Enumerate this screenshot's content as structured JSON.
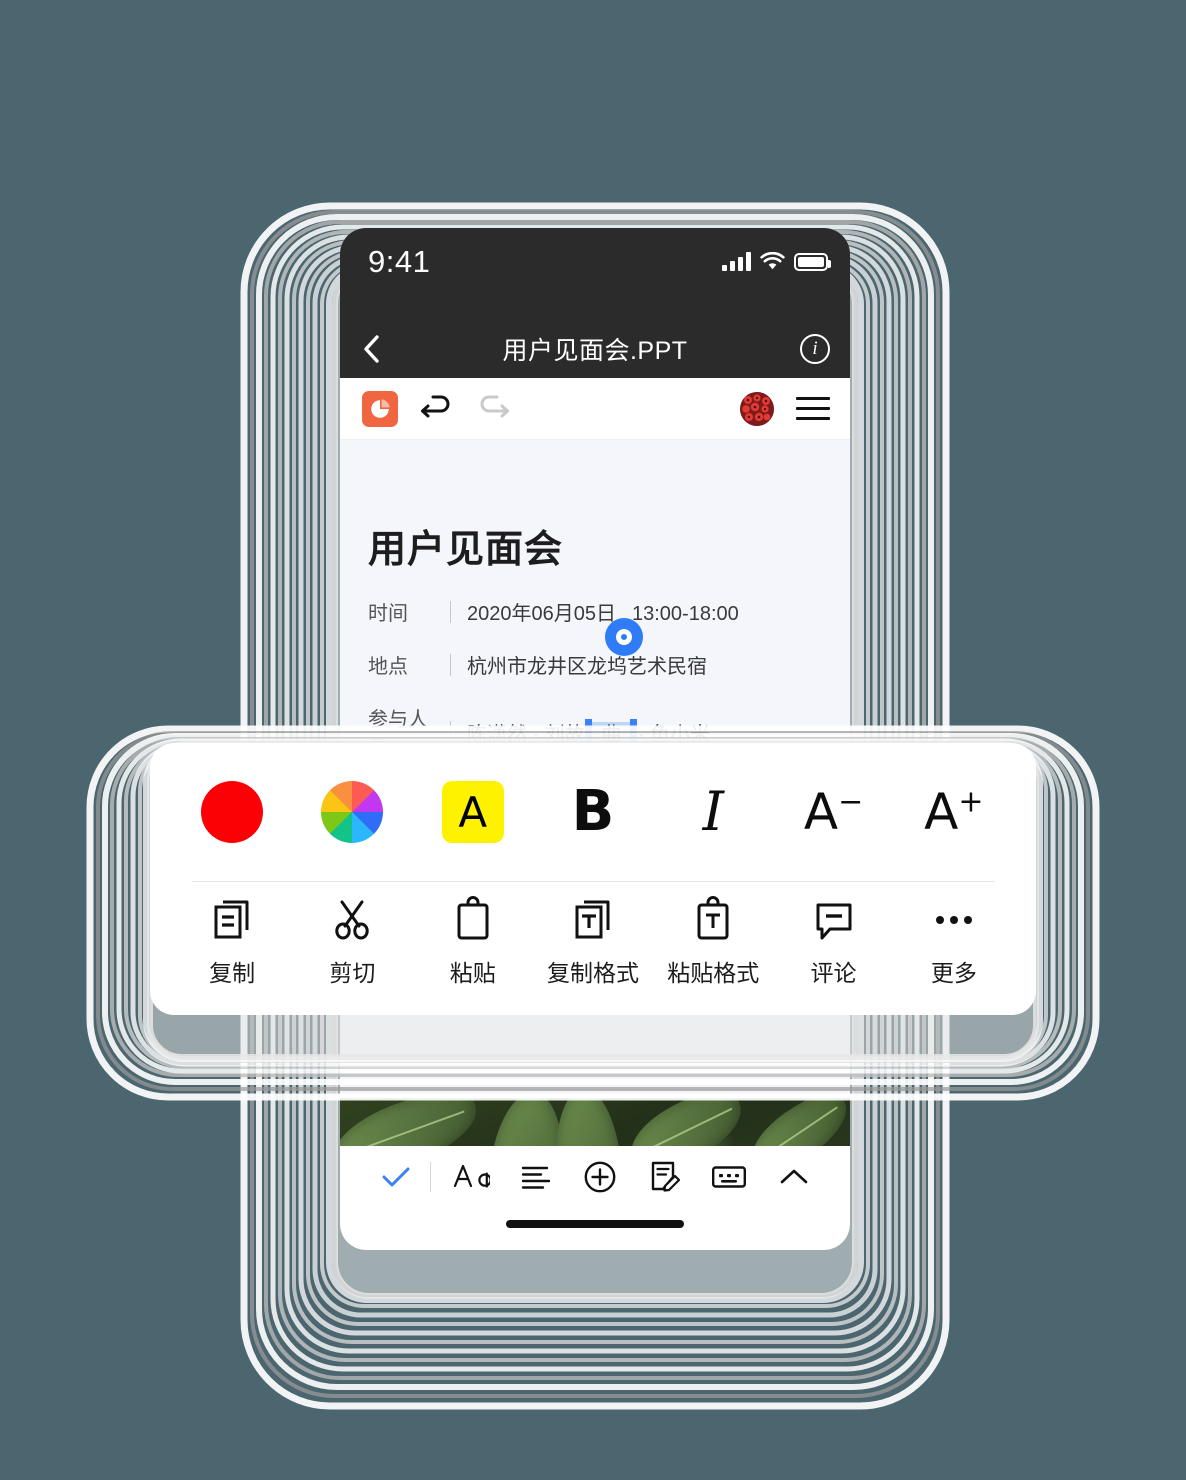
{
  "background_color": "#4b666f",
  "status_bar": {
    "time": "9:41",
    "signal_icon": "cellular-bars-icon",
    "wifi_icon": "wifi-icon",
    "battery_icon": "battery-full-icon"
  },
  "nav_bar": {
    "back_icon": "chevron-left-icon",
    "title": "用户见面会.PPT",
    "info_label": "i",
    "info_icon": "info-circle-icon"
  },
  "app_toolbar": {
    "app_icon": "presentation-pie-icon",
    "undo_icon": "undo-arrow-icon",
    "redo_icon": "redo-arrow-icon",
    "avatar_icon": "user-avatar",
    "menu_icon": "hamburger-menu-icon"
  },
  "document": {
    "title": "用户见面会",
    "meta": [
      {
        "label": "时间",
        "value_a": "2020年06月05日",
        "value_b": "13:00-18:00"
      },
      {
        "label": "地点",
        "value_a": "杭州市龙井区龙坞艺术民宿",
        "value_b": ""
      }
    ],
    "attendees": {
      "label": "参与人员",
      "before": "陈潇然 · 刘故",
      "selected": "曲",
      "after": "· 鱼小米"
    },
    "selection_handle_icon": "selection-handle-icon",
    "selection_color": "#bcd7f5",
    "selection_bar_color": "#3b82f6",
    "photo_alt": "green-leaves-photo"
  },
  "format_popup": {
    "row1": [
      {
        "name": "text-color-swatch",
        "icon": "red-circle-icon",
        "color": "#fb0004"
      },
      {
        "name": "color-wheel",
        "icon": "color-wheel-icon"
      },
      {
        "name": "highlight",
        "icon": "highlight-a-icon",
        "glyph": "A",
        "color": "#fff200"
      },
      {
        "name": "bold",
        "icon": "bold-icon",
        "glyph": "B"
      },
      {
        "name": "italic",
        "icon": "italic-icon",
        "glyph": "I"
      },
      {
        "name": "decrease-font-size",
        "icon": "a-minus-icon",
        "glyph": "A",
        "sup": "−"
      },
      {
        "name": "increase-font-size",
        "icon": "a-plus-icon",
        "glyph": "A",
        "sup": "+"
      }
    ],
    "row2": [
      {
        "label": "复制",
        "icon": "copy-icon"
      },
      {
        "label": "剪切",
        "icon": "scissors-cut-icon"
      },
      {
        "label": "粘贴",
        "icon": "clipboard-paste-icon"
      },
      {
        "label": "复制格式",
        "icon": "copy-format-icon"
      },
      {
        "label": "粘贴格式",
        "icon": "paste-format-icon"
      },
      {
        "label": "评论",
        "icon": "comment-bubble-icon"
      },
      {
        "label": "更多",
        "icon": "more-ellipsis-icon"
      }
    ]
  },
  "bottom_toolbar": {
    "items": [
      {
        "name": "confirm",
        "icon": "checkmark-icon",
        "color": "#3b82f6"
      },
      {
        "name": "font",
        "icon": "font-aa-icon"
      },
      {
        "name": "paragraph-align",
        "icon": "align-lines-icon"
      },
      {
        "name": "insert",
        "icon": "plus-circle-icon"
      },
      {
        "name": "note",
        "icon": "note-edit-icon"
      },
      {
        "name": "keyboard",
        "icon": "keyboard-icon"
      },
      {
        "name": "collapse",
        "icon": "chevron-up-icon"
      }
    ],
    "home_indicator": "home-indicator"
  }
}
